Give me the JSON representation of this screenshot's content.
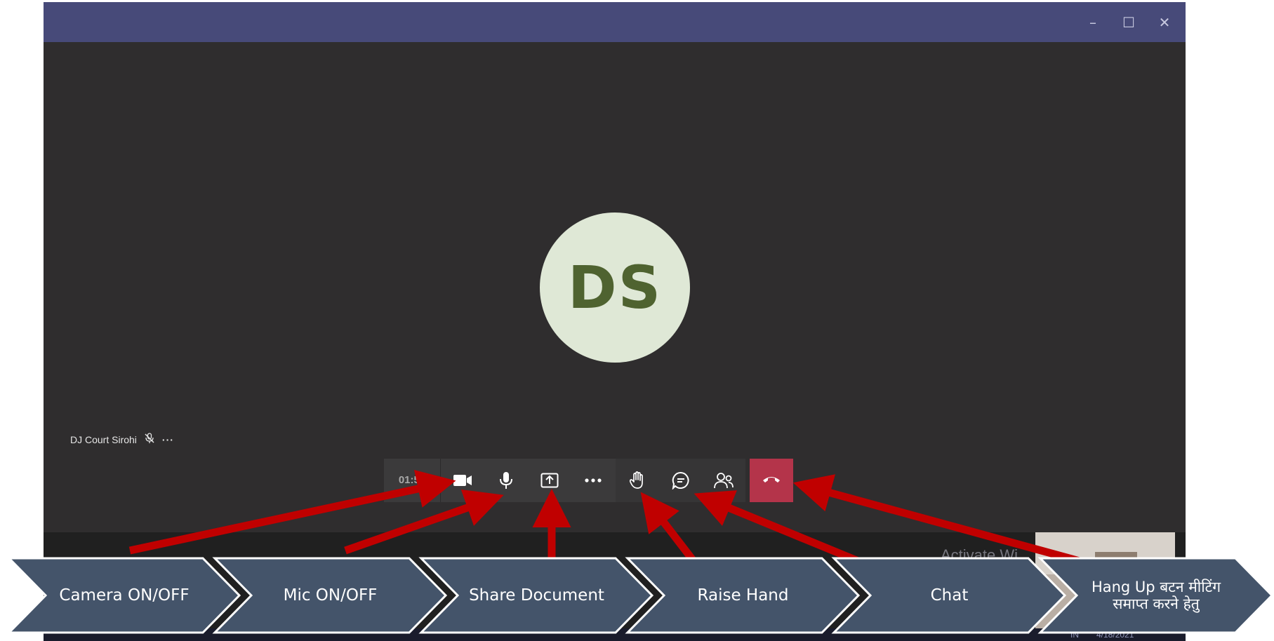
{
  "window": {
    "controls": {
      "minimize": "–",
      "maximize": "☐",
      "close": "✕"
    }
  },
  "participant": {
    "initials": "DS",
    "name": "DJ Court Sirohi",
    "more": "···"
  },
  "toolbar": {
    "timer": "01:55",
    "buttons": [
      "camera-icon",
      "mic-icon",
      "share-icon",
      "more-icon",
      "raise-hand-icon",
      "chat-icon",
      "participants-icon",
      "hang-up-icon"
    ]
  },
  "watermark": {
    "text": "Activate Wi"
  },
  "taskbar": {
    "lang": "IN",
    "date": "4/18/2021"
  },
  "annotations": {
    "camera": "Camera ON/OFF",
    "mic": "Mic ON/OFF",
    "share": "Share Document",
    "raise_hand": "Raise Hand",
    "chat": "Chat",
    "hangup": "Hang Up बटन मीटिंग समाप्त करने हेतु"
  },
  "colors": {
    "titlebar": "#474a79",
    "stage": "#2f2d2e",
    "hangup": "#b4344a",
    "arrow": "#c00000",
    "chevron": "#44546a"
  }
}
